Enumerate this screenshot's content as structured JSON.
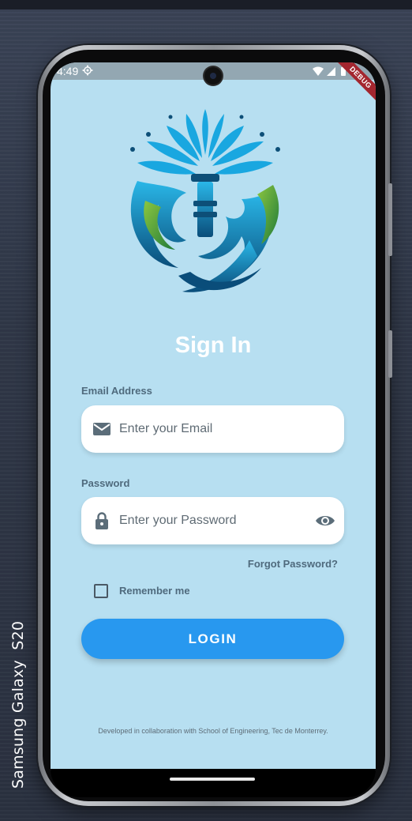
{
  "device": {
    "label": "Samsung Galaxy  S20"
  },
  "status_bar": {
    "time": "4:49",
    "debug_banner": "DEBUG",
    "icons": [
      "gear-icon",
      "wifi-icon",
      "signal-icon",
      "battery-icon"
    ]
  },
  "app": {
    "title": "Sign In",
    "email": {
      "label": "Email Address",
      "placeholder": "Enter your Email",
      "icon": "mail-icon"
    },
    "password": {
      "label": "Password",
      "placeholder": "Enter your Password",
      "icon": "lock-icon",
      "toggle_icon": "eye-icon"
    },
    "forgot_password": "Forgot Password?",
    "remember_me": {
      "label": "Remember me",
      "checked": false
    },
    "login_button": "LOGIN",
    "footer": "Developed in collaboration with School of Engineering, Tec de Monterrey."
  },
  "colors": {
    "screen_bg": "#b7dff1",
    "primary": "#2898ef",
    "text_muted": "#4f6a7d",
    "debug": "#a3262f"
  }
}
